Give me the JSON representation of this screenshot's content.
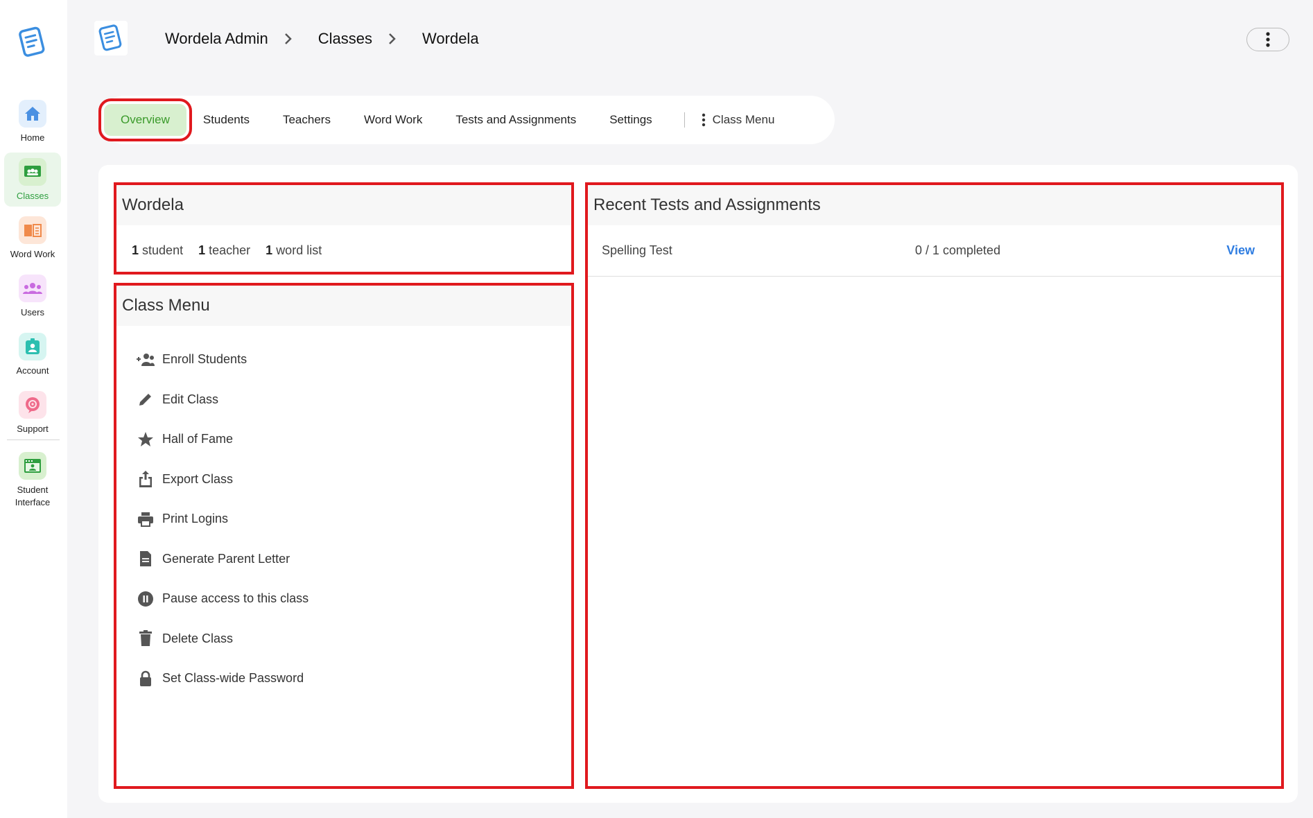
{
  "sidebar": {
    "items": [
      {
        "label": "Home",
        "icon": "home-icon",
        "color": "#4a90e2",
        "bg": "#e3effc"
      },
      {
        "label": "Classes",
        "icon": "classes-icon",
        "color": "#2e9e3f",
        "bg": "#d8f0cf"
      },
      {
        "label": "Word Work",
        "icon": "book-icon",
        "color": "#f08a4b",
        "bg": "#fde6d8"
      },
      {
        "label": "Users",
        "icon": "users-icon",
        "color": "#c96be0",
        "bg": "#f7e4fb"
      },
      {
        "label": "Account",
        "icon": "badge-icon",
        "color": "#2bbfb0",
        "bg": "#d6f5f1"
      },
      {
        "label": "Support",
        "icon": "support-icon",
        "color": "#ef6a8a",
        "bg": "#fde3ea"
      },
      {
        "label": "Student Interface",
        "icon": "student-interface-icon",
        "color": "#2e9e3f",
        "bg": "#d8f0cf"
      }
    ]
  },
  "breadcrumb": {
    "items": [
      "Wordela Admin",
      "Classes",
      "Wordela"
    ]
  },
  "tabs": {
    "items": [
      "Overview",
      "Students",
      "Teachers",
      "Word Work",
      "Tests and Assignments",
      "Settings"
    ],
    "menu_label": "Class Menu",
    "active": "Overview"
  },
  "summary": {
    "title": "Wordela",
    "students_count": "1",
    "students_label": "student",
    "teachers_count": "1",
    "teachers_label": "teacher",
    "wordlists_count": "1",
    "wordlists_label": "word list"
  },
  "class_menu": {
    "title": "Class Menu",
    "items": [
      {
        "label": "Enroll Students",
        "icon": "enroll-users-icon"
      },
      {
        "label": "Edit Class",
        "icon": "pencil-icon"
      },
      {
        "label": "Hall of Fame",
        "icon": "star-icon"
      },
      {
        "label": "Export Class",
        "icon": "export-icon"
      },
      {
        "label": "Print Logins",
        "icon": "printer-icon"
      },
      {
        "label": "Generate Parent Letter",
        "icon": "document-icon"
      },
      {
        "label": "Pause access to this class",
        "icon": "pause-icon"
      },
      {
        "label": "Delete Class",
        "icon": "trash-icon"
      },
      {
        "label": "Set Class-wide Password",
        "icon": "lock-icon"
      }
    ]
  },
  "recent": {
    "title": "Recent Tests and Assignments",
    "rows": [
      {
        "name": "Spelling Test",
        "progress": "0 / 1 completed",
        "action": "View"
      }
    ]
  },
  "colors": {
    "accent_green": "#3a9a2a",
    "highlight_red": "#e0191e",
    "link_blue": "#2f7de1"
  }
}
